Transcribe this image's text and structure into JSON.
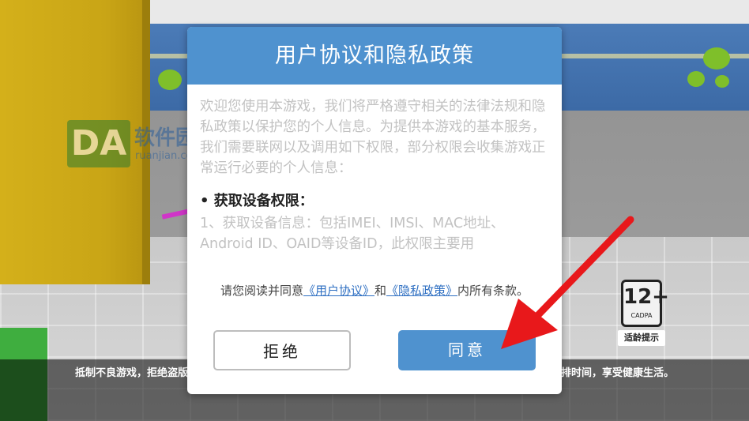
{
  "watermark": {
    "logo_text": "DA",
    "name": "软件园",
    "url": "ruanjian.com"
  },
  "notice": {
    "left": "抵制不良游戏，拒绝盗版",
    "right": "排时间，享受健康生活。"
  },
  "age_rating": {
    "value": "12+",
    "org": "CADPA",
    "label": "适龄提示"
  },
  "dialog": {
    "title": "用户协议和隐私政策",
    "intro": "欢迎您使用本游戏，我们将严格遵守相关的法律法规和隐私政策以保护您的个人信息。为提供本游戏的基本服务，我们需要联网以及调用如下权限，部分权限会收集游戏正常运行必要的个人信息：",
    "section_title": "• 获取设备权限：",
    "section_body": "1、获取设备信息：包括IMEI、IMSI、MAC地址、Android ID、OAID等设备ID，此权限主要用",
    "agree_prefix": "请您阅读并同意",
    "user_agreement_link": "《用户协议》",
    "agree_and": "和",
    "privacy_link": "《隐私政策》",
    "agree_suffix": "内所有条款。",
    "reject_label": "拒绝",
    "accept_label": "同意"
  },
  "colors": {
    "header_blue": "#4f92cf",
    "link_blue": "#2e6fc2",
    "arrow_red": "#e8181b"
  },
  "icons": {
    "arrow": "red-arrow-pointer"
  }
}
